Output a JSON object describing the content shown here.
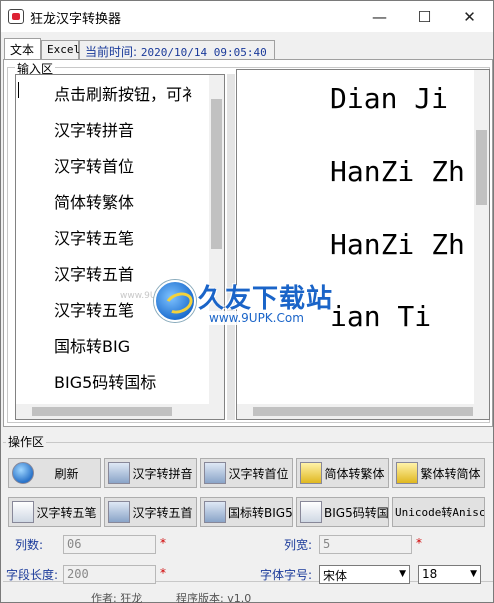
{
  "window": {
    "title": "狂龙汉字转换器"
  },
  "tabs": [
    {
      "label": "文本"
    },
    {
      "label": "Excel"
    }
  ],
  "time": {
    "label": "当前时间:",
    "value": "2020/10/14  09:05:40"
  },
  "input_area": {
    "label": "输入区",
    "lines": [
      "点击刷新按钮，可衤",
      "汉字转拼音",
      "汉字转首位",
      "简体转繁体",
      "汉字转五笔",
      "汉字转五首",
      "汉字转五笔",
      "国标转BIG",
      "BIG5码转国标"
    ]
  },
  "output_area": {
    "lines": [
      "Dian Ji",
      "HanZi Zh",
      "HanZi Zh",
      "ian Ti"
    ]
  },
  "watermark": {
    "title": "久友下载站",
    "url": "www.9UPK.Com",
    "small": "www.9UPK.com"
  },
  "ops": {
    "label": "操作区",
    "buttons_row1": [
      "刷新",
      "汉字转拼音",
      "汉字转首位",
      "简体转繁体",
      "繁体转简体"
    ],
    "buttons_row2": [
      "汉字转五笔",
      "汉字转五首",
      "国标转BIG5",
      "BIG5码转国标",
      "Unicode转Anisc"
    ]
  },
  "fields": {
    "cols_label": "列数:",
    "cols_value": "06",
    "width_label": "列宽:",
    "width_value": "5",
    "len_label": "字段长度:",
    "len_value": "200",
    "font_label": "字体字号:",
    "font_name": "宋体",
    "font_size": "18",
    "required": "*"
  },
  "footer": {
    "author": "作者: 狂龙",
    "version": "程序版本: v1.0"
  }
}
